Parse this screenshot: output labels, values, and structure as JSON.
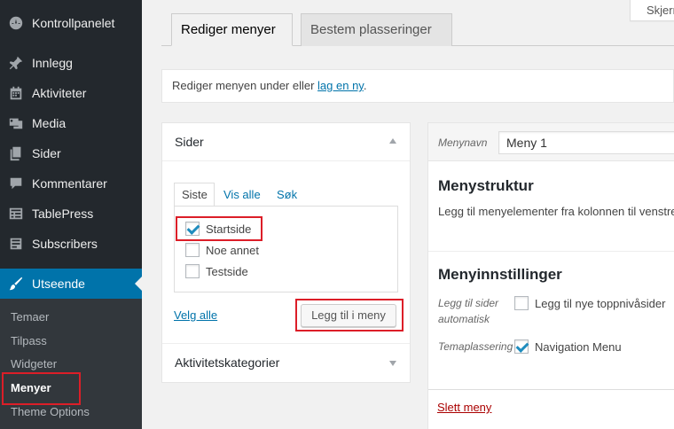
{
  "sidebar": {
    "items": [
      {
        "label": "Kontrollpanelet",
        "icon": "dashboard-icon"
      },
      {
        "label": "Innlegg",
        "icon": "pin-icon"
      },
      {
        "label": "Aktiviteter",
        "icon": "calendar-icon"
      },
      {
        "label": "Media",
        "icon": "media-icon"
      },
      {
        "label": "Sider",
        "icon": "pages-icon"
      },
      {
        "label": "Kommentarer",
        "icon": "comment-icon"
      },
      {
        "label": "TablePress",
        "icon": "table-icon"
      },
      {
        "label": "Subscribers",
        "icon": "subscribers-icon"
      },
      {
        "label": "Utseende",
        "icon": "brush-icon"
      }
    ],
    "submenu": [
      "Temaer",
      "Tilpass",
      "Widgeter",
      "Menyer",
      "Theme Options"
    ]
  },
  "screen_options_label": "Skjerm",
  "tabs": [
    {
      "label": "Rediger menyer"
    },
    {
      "label": "Bestem plasseringer"
    }
  ],
  "notice": {
    "text": "Rediger menyen under eller ",
    "link": "lag en ny",
    "suffix": "."
  },
  "pages_box": {
    "title": "Sider",
    "tabs": [
      "Siste",
      "Vis alle",
      "Søk"
    ],
    "pages": [
      {
        "label": "Startside",
        "checked": true
      },
      {
        "label": "Noe annet",
        "checked": false
      },
      {
        "label": "Testside",
        "checked": false
      }
    ],
    "select_all": "Velg alle",
    "add_button": "Legg til i meny"
  },
  "categories_box": {
    "title": "Aktivitetskategorier"
  },
  "menu": {
    "name_label": "Menynavn",
    "name_value": "Meny 1",
    "structure_title": "Menystruktur",
    "structure_desc": "Legg til menyelementer fra kolonnen til venstre.",
    "settings_title": "Menyinnstillinger",
    "auto_add_label": "Legg til sider automatisk",
    "auto_add_option": "Legg til nye toppnivåsider",
    "locations_label": "Temaplassering",
    "location_option": "Navigation Menu",
    "delete_link": "Slett meny"
  },
  "colors": {
    "sidebar_bg": "#23282d",
    "accent": "#0073aa",
    "highlight": "#dc1e28"
  }
}
